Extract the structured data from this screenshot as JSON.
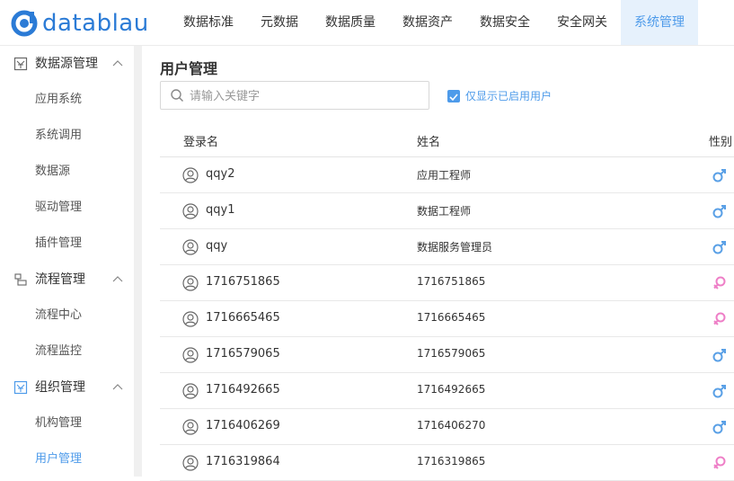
{
  "app": {
    "logo_text": "datablau"
  },
  "nav": {
    "items": [
      {
        "label": "数据标准"
      },
      {
        "label": "元数据"
      },
      {
        "label": "数据质量"
      },
      {
        "label": "数据资产"
      },
      {
        "label": "数据安全"
      },
      {
        "label": "安全网关"
      },
      {
        "label": "系统管理",
        "active": true
      }
    ]
  },
  "sidebar": {
    "groups": [
      {
        "label": "数据源管理",
        "icon": "datasource-icon",
        "items": [
          "应用系统",
          "系统调用",
          "数据源",
          "驱动管理",
          "插件管理"
        ]
      },
      {
        "label": "流程管理",
        "icon": "process-icon",
        "items": [
          "流程中心",
          "流程监控"
        ]
      },
      {
        "label": "组织管理",
        "icon": "org-icon",
        "items": [
          "机构管理",
          "用户管理"
        ]
      }
    ],
    "active_item": "用户管理"
  },
  "main": {
    "title": "用户管理",
    "search": {
      "placeholder": "请输入关键字",
      "value": ""
    },
    "filter": {
      "label": "仅显示已启用用户",
      "checked": true
    },
    "table": {
      "columns": [
        "登录名",
        "姓名",
        "性别"
      ],
      "rows": [
        {
          "login": "qqy2",
          "name": "应用工程师",
          "gender": "male"
        },
        {
          "login": "qqy1",
          "name": "数据工程师",
          "gender": "male"
        },
        {
          "login": "qqy",
          "name": "数据服务管理员",
          "gender": "male"
        },
        {
          "login": "1716751865",
          "name": "1716751865",
          "gender": "female"
        },
        {
          "login": "1716665465",
          "name": "1716665465",
          "gender": "female"
        },
        {
          "login": "1716579065",
          "name": "1716579065",
          "gender": "male"
        },
        {
          "login": "1716492665",
          "name": "1716492665",
          "gender": "male"
        },
        {
          "login": "1716406269",
          "name": "1716406270",
          "gender": "male"
        },
        {
          "login": "1716319864",
          "name": "1716319865",
          "gender": "female"
        }
      ]
    }
  },
  "colors": {
    "accent": "#4e9bea",
    "male": "#5aa0e6",
    "female": "#ee7fc7"
  }
}
